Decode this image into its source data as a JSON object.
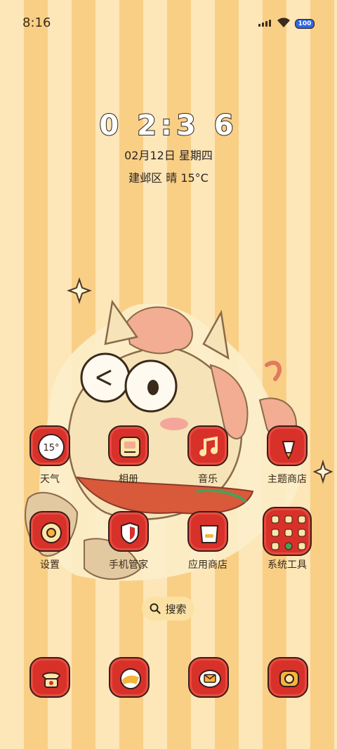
{
  "status_bar": {
    "time": "8:16",
    "battery": "100",
    "icons": [
      "signal-icon",
      "wifi-icon",
      "battery-icon"
    ]
  },
  "clock_widget": {
    "time": "0 2:3 6",
    "date": "02月12日 星期四",
    "weather": "建邺区 晴 15°C"
  },
  "apps": [
    {
      "label": "天气",
      "icon": "weather-icon",
      "badge": "15°"
    },
    {
      "label": "相册",
      "icon": "gallery-icon"
    },
    {
      "label": "音乐",
      "icon": "music-icon"
    },
    {
      "label": "主题商店",
      "icon": "theme-store-icon"
    },
    {
      "label": "设置",
      "icon": "settings-icon"
    },
    {
      "label": "手机管家",
      "icon": "security-icon"
    },
    {
      "label": "应用商店",
      "icon": "app-store-icon"
    },
    {
      "label": "系统工具",
      "icon": "system-tools-folder-icon"
    }
  ],
  "search": {
    "label": "搜索"
  },
  "dock": [
    {
      "icon": "phone-icon"
    },
    {
      "icon": "browser-icon"
    },
    {
      "icon": "messages-icon"
    },
    {
      "icon": "camera-icon"
    }
  ],
  "colors": {
    "icon_red": "#d8312a",
    "stripe_light": "#fde6b8",
    "stripe_dark": "#f9cf86",
    "outline": "#3a1d1a"
  }
}
